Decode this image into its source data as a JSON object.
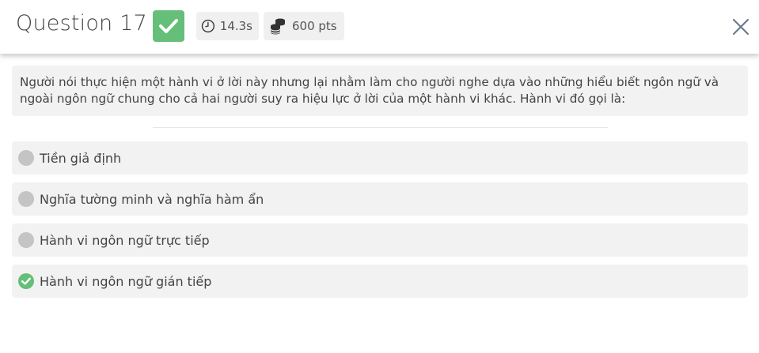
{
  "header": {
    "title": "Question 17",
    "time": "14.3s",
    "points": "600 pts"
  },
  "question": {
    "text": "Người nói thực hiện một hành vi ở lời này nhưng lại nhằm làm cho người nghe dựa vào những hiểu biết ngôn ngữ và ngoài ngôn ngữ chung cho cả hai người suy ra hiệu lực ở lời của một hành vi khác. Hành vi đó gọi là:"
  },
  "options": [
    {
      "label": "Tiền giả định",
      "state": "unselected"
    },
    {
      "label": "Nghĩa tường minh và nghĩa hàm ẩn",
      "state": "unselected"
    },
    {
      "label": "Hành vi ngôn ngữ trực tiếp",
      "state": "unselected"
    },
    {
      "label": "Hành vi ngôn ngữ gián tiếp",
      "state": "correct"
    }
  ],
  "colors": {
    "correct": "#66bf78",
    "radio": "#c4c4c4",
    "option_bg": "#f2f2f2",
    "close_icon": "#6a7b8c"
  },
  "icons": {
    "correct_badge": "check-icon",
    "time": "clock-icon",
    "points": "coins-icon",
    "close": "close-icon"
  }
}
